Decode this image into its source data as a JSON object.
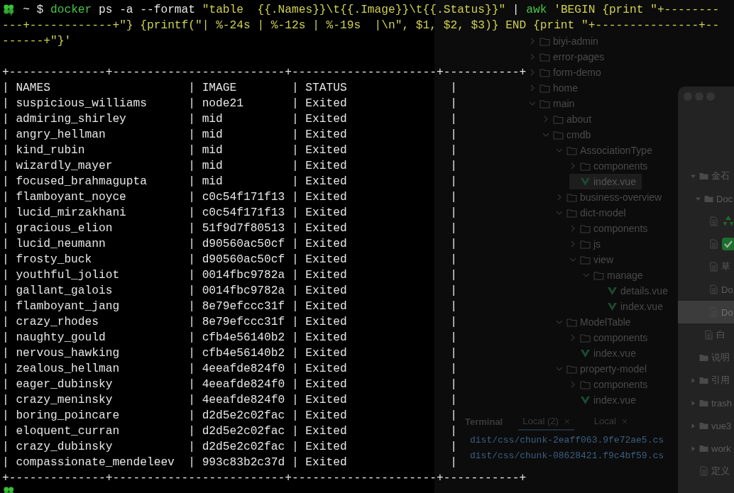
{
  "terminal": {
    "prompt": "~ $",
    "command_lines": [
      [
        {
          "kind": "program",
          "text": "docker"
        },
        {
          "kind": "plain",
          "text": " ps -a --format "
        },
        {
          "kind": "string",
          "text": "\"table  {{.Names}}\\t{{.Image}}\\t{{.Status}}\""
        },
        {
          "kind": "plain",
          "text": " | "
        },
        {
          "kind": "program",
          "text": "awk"
        },
        {
          "kind": "string",
          "text": " 'BEGIN {print \"+--------"
        }
      ],
      [
        {
          "kind": "string",
          "text": "---+------------+\"} {printf(\"| %-24s | %-12s | %-19s  |\\n\", $1, $2, $3)} END {print \"+---------------+--"
        }
      ],
      [
        {
          "kind": "string",
          "text": "------+\"}'"
        }
      ]
    ],
    "table": {
      "top_border": "+--------------+-------------------------+---------------------+-----------+",
      "separator": "|",
      "header": [
        "NAMES",
        "IMAGE",
        "STATUS"
      ],
      "rows": [
        [
          "suspicious_williams",
          "node21",
          "Exited"
        ],
        [
          "admiring_shirley",
          "mid",
          "Exited"
        ],
        [
          "angry_hellman",
          "mid",
          "Exited"
        ],
        [
          "kind_rubin",
          "mid",
          "Exited"
        ],
        [
          "wizardly_mayer",
          "mid",
          "Exited"
        ],
        [
          "focused_brahmagupta",
          "mid",
          "Exited"
        ],
        [
          "flamboyant_noyce",
          "c0c54f171f13",
          "Exited"
        ],
        [
          "lucid_mirzakhani",
          "c0c54f171f13",
          "Exited"
        ],
        [
          "gracious_elion",
          "51f9d7f80513",
          "Exited"
        ],
        [
          "lucid_neumann",
          "d90560ac50cf",
          "Exited"
        ],
        [
          "frosty_buck",
          "d90560ac50cf",
          "Exited"
        ],
        [
          "youthful_joliot",
          "0014fbc9782a",
          "Exited"
        ],
        [
          "gallant_galois",
          "0014fbc9782a",
          "Exited"
        ],
        [
          "flamboyant_jang",
          "8e79efccc31f",
          "Exited"
        ],
        [
          "crazy_rhodes",
          "8e79efccc31f",
          "Exited"
        ],
        [
          "naughty_gould",
          "cfb4e56140b2",
          "Exited"
        ],
        [
          "nervous_hawking",
          "cfb4e56140b2",
          "Exited"
        ],
        [
          "zealous_hellman",
          "4eeafde824f0",
          "Exited"
        ],
        [
          "eager_dubinsky",
          "4eeafde824f0",
          "Exited"
        ],
        [
          "crazy_meninsky",
          "4eeafde824f0",
          "Exited"
        ],
        [
          "boring_poincare",
          "d2d5e2c02fac",
          "Exited"
        ],
        [
          "eloquent_curran",
          "d2d5e2c02fac",
          "Exited"
        ],
        [
          "crazy_dubinsky",
          "d2d5e2c02fac",
          "Exited"
        ],
        [
          "compassionate_mendeleev",
          "993c83b2c37d",
          "Exited"
        ]
      ],
      "bottom_border": "+--------------+-------------------------+---------------------+-----------+"
    }
  },
  "editor": {
    "tree": [
      {
        "name": "biyi-admin",
        "kind": "folder",
        "expanded": false,
        "selected": false
      },
      {
        "name": "error-pages",
        "kind": "folder",
        "expanded": false,
        "selected": false
      },
      {
        "name": "form-demo",
        "kind": "folder",
        "expanded": false,
        "selected": false
      },
      {
        "name": "home",
        "kind": "folder",
        "expanded": false,
        "selected": false
      },
      {
        "name": "main",
        "kind": "folder",
        "expanded": true,
        "selected": false,
        "children": [
          {
            "name": "about",
            "kind": "folder",
            "expanded": false,
            "selected": false
          },
          {
            "name": "cmdb",
            "kind": "folder",
            "expanded": true,
            "selected": false,
            "children": [
              {
                "name": "AssociationType",
                "kind": "folder",
                "expanded": true,
                "selected": false,
                "children": [
                  {
                    "name": "components",
                    "kind": "folder",
                    "expanded": false,
                    "selected": false
                  },
                  {
                    "name": "index.vue",
                    "kind": "vue",
                    "selected": true
                  }
                ]
              },
              {
                "name": "business-overview",
                "kind": "folder",
                "expanded": false,
                "selected": false
              },
              {
                "name": "dict-model",
                "kind": "folder",
                "expanded": true,
                "selected": false,
                "children": [
                  {
                    "name": "components",
                    "kind": "folder",
                    "expanded": false,
                    "selected": false
                  },
                  {
                    "name": "js",
                    "kind": "folder",
                    "expanded": false,
                    "selected": false
                  },
                  {
                    "name": "view",
                    "kind": "folder",
                    "expanded": true,
                    "selected": false,
                    "children": [
                      {
                        "name": "manage",
                        "kind": "folder",
                        "expanded": true,
                        "selected": false,
                        "children": [
                          {
                            "name": "details.vue",
                            "kind": "vue",
                            "selected": false
                          },
                          {
                            "name": "index.vue",
                            "kind": "vue",
                            "selected": false
                          }
                        ]
                      }
                    ]
                  }
                ]
              },
              {
                "name": "ModelTable",
                "kind": "folder",
                "expanded": true,
                "selected": false,
                "children": [
                  {
                    "name": "components",
                    "kind": "folder",
                    "expanded": false,
                    "selected": false
                  },
                  {
                    "name": "index.vue",
                    "kind": "vue",
                    "selected": false
                  }
                ]
              },
              {
                "name": "property-model",
                "kind": "folder",
                "expanded": true,
                "selected": false,
                "children": [
                  {
                    "name": "components",
                    "kind": "folder",
                    "expanded": false,
                    "selected": false
                  },
                  {
                    "name": "index.vue",
                    "kind": "vue",
                    "selected": false
                  }
                ]
              }
            ]
          }
        ]
      }
    ],
    "panel_title": "Terminal",
    "panel_tabs": [
      {
        "label": "Local (2)",
        "selected": true
      },
      {
        "label": "Local",
        "selected": false
      }
    ],
    "panel_lines": [
      "dist/css/chunk-2eaff063.9fe72ae5.cs",
      "dist/css/chunk-08628421.f9c4bf59.cs"
    ]
  },
  "notes_window": {
    "items": [
      {
        "kind": "folder",
        "name": "金石",
        "expanded": true,
        "selected": false,
        "children": [
          {
            "kind": "folder",
            "name": "Doc",
            "expanded": true,
            "selected": false,
            "children": [
              {
                "kind": "recycle",
                "selected": false
              },
              {
                "kind": "check",
                "selected": false
              },
              {
                "kind": "doc",
                "name": "草",
                "selected": false
              },
              {
                "kind": "doc",
                "name": "Do",
                "selected": false
              },
              {
                "kind": "doc",
                "name": "Do",
                "selected": true
              }
            ]
          },
          {
            "kind": "doc",
            "name": "白",
            "selected": false
          }
        ]
      },
      {
        "kind": "folder",
        "name": "说明",
        "selected": false
      },
      {
        "kind": "folder",
        "name": "引用",
        "expanded": false,
        "selected": false
      },
      {
        "kind": "folder",
        "name": "trash",
        "expanded": false,
        "selected": false
      },
      {
        "kind": "folder",
        "name": "vue3",
        "expanded": false,
        "selected": false
      },
      {
        "kind": "folder",
        "name": "work",
        "expanded": false,
        "selected": false
      },
      {
        "kind": "doc",
        "name": "定义",
        "selected": false
      }
    ]
  }
}
